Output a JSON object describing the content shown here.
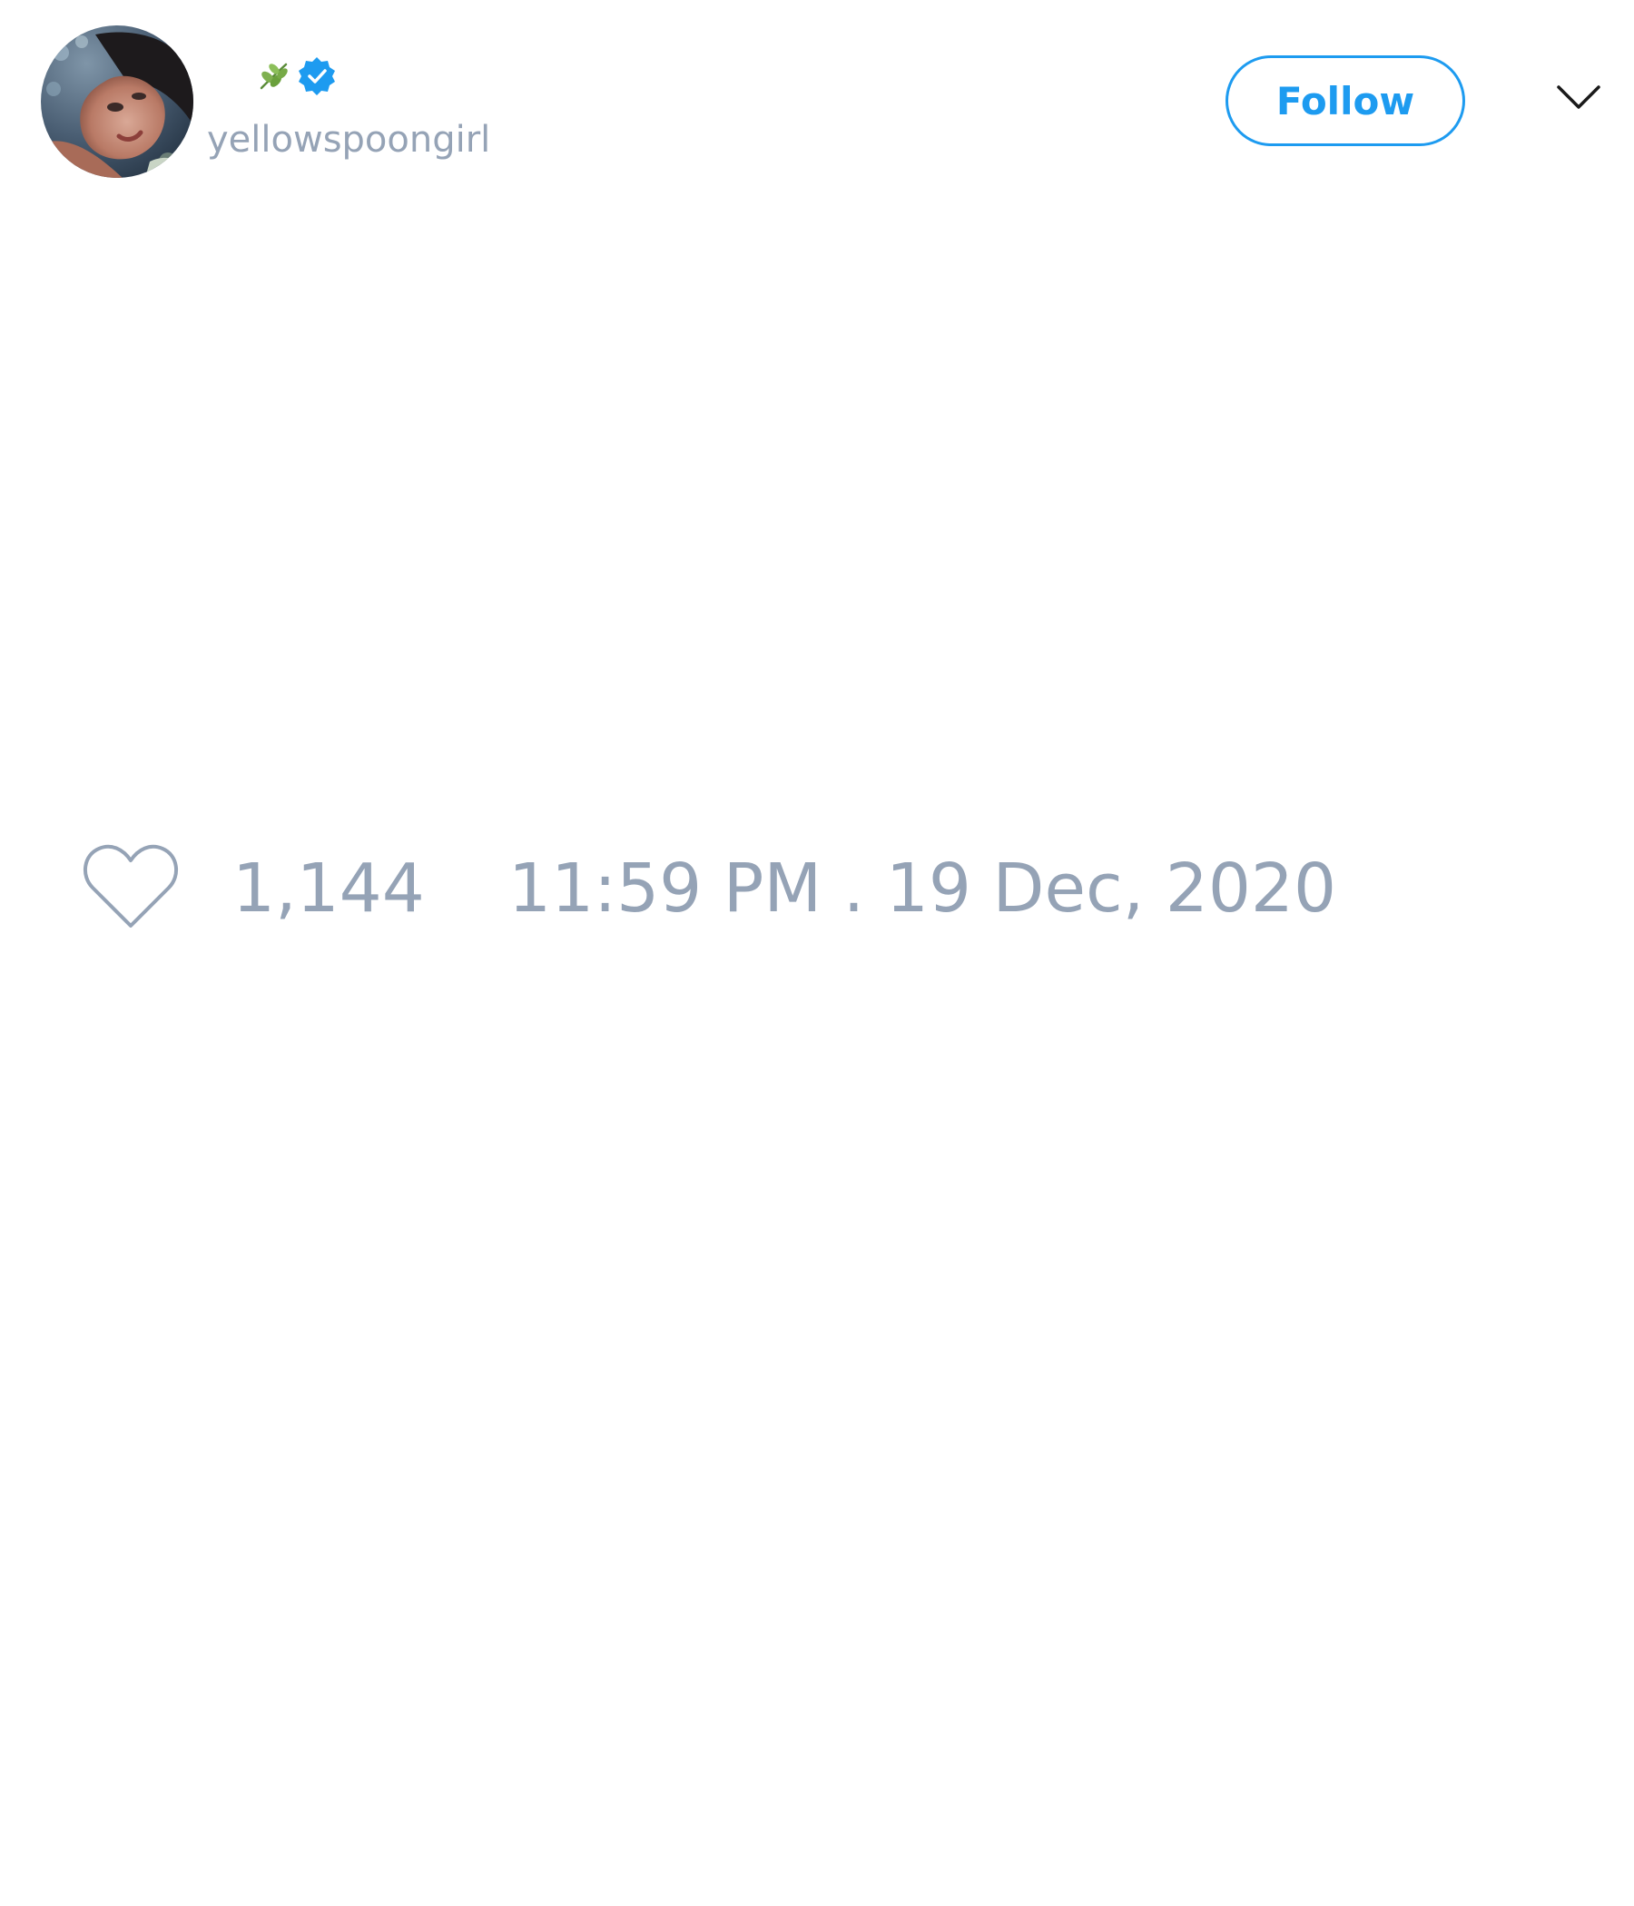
{
  "author": {
    "display_name_emoji": "🌿",
    "verified": true,
    "handle": "yellowspoongirl"
  },
  "actions": {
    "follow_label": "Follow"
  },
  "engagement": {
    "like_count": "1,144"
  },
  "meta": {
    "timestamp": "11:59 PM . 19 Dec, 2020"
  },
  "icons": {
    "leaf": "leaf-icon",
    "verified": "verified-badge-icon",
    "chevron": "chevron-down-icon",
    "heart": "heart-icon"
  },
  "colors": {
    "accent": "#1d9bf0",
    "muted_text": "#95a3b6",
    "background": "#ffffff"
  }
}
